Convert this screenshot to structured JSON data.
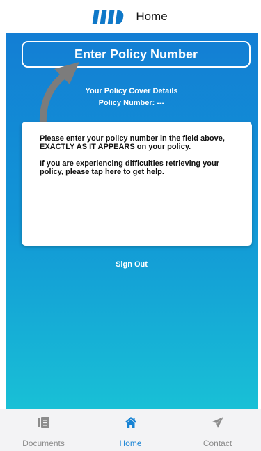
{
  "header": {
    "title": "Home"
  },
  "main": {
    "policy_button_label": "Enter Policy Number",
    "cover_details_title": "Your Policy Cover Details",
    "policy_number_line": "Policy Number:  ---",
    "card": {
      "paragraph1": "Please enter your policy number in the field above, EXACTLY AS IT APPEARS on your policy.",
      "paragraph2": "If you are experiencing difficulties retrieving your policy, please tap here to get help."
    },
    "signout_label": "Sign Out"
  },
  "tabs": [
    {
      "label": "Documents",
      "icon": "documents-icon",
      "active": false
    },
    {
      "label": "Home",
      "icon": "home-icon",
      "active": true
    },
    {
      "label": "Contact",
      "icon": "paper-plane-icon",
      "active": false
    }
  ],
  "colors": {
    "brand_blue": "#0f78c8",
    "gradient_top": "#137ed4",
    "gradient_bottom": "#19c0d6",
    "tab_active": "#1783d4",
    "tab_inactive": "#8c8c8c"
  }
}
